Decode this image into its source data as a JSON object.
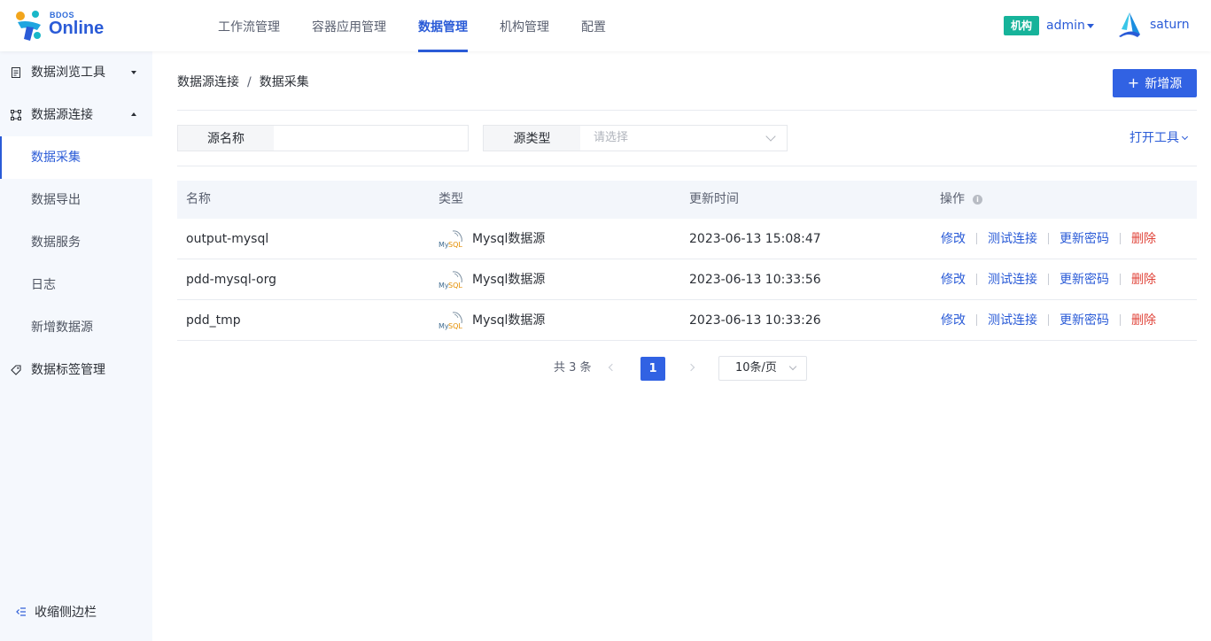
{
  "header": {
    "logo_small": "BDOS",
    "logo_big": "Online",
    "nav": [
      "工作流管理",
      "容器应用管理",
      "数据管理",
      "机构管理",
      "配置"
    ],
    "active_nav": "数据管理",
    "org_badge": "机构",
    "user": "admin",
    "tenant": "saturn",
    "colors": {
      "accent": "#2a5bd7",
      "badge": "#16b39a"
    }
  },
  "sidebar": {
    "items": [
      {
        "label": "数据浏览工具",
        "icon": "report-icon"
      },
      {
        "label": "数据源连接",
        "icon": "connection-icon"
      },
      {
        "label": "数据标签管理",
        "icon": "tag-icon"
      }
    ],
    "sub_items": [
      "数据采集",
      "数据导出",
      "数据服务",
      "日志",
      "新增数据源"
    ],
    "active_sub": "数据采集",
    "collapse_label": "收缩侧边栏"
  },
  "main": {
    "breadcrumb": [
      "数据源连接",
      "数据采集"
    ],
    "add_button": "新增源",
    "filters": {
      "name_label": "源名称",
      "name_value": "",
      "type_label": "源类型",
      "type_placeholder": "请选择"
    },
    "open_tools": "打开工具",
    "table": {
      "columns": [
        "名称",
        "类型",
        "更新时间",
        "操作"
      ],
      "rows": [
        {
          "name": "output-mysql",
          "type": "Mysql数据源",
          "updated": "2023-06-13 15:08:47"
        },
        {
          "name": "pdd-mysql-org",
          "type": "Mysql数据源",
          "updated": "2023-06-13 10:33:56"
        },
        {
          "name": "pdd_tmp",
          "type": "Mysql数据源",
          "updated": "2023-06-13 10:33:26"
        }
      ],
      "actions": [
        "修改",
        "测试连接",
        "更新密码",
        "删除"
      ]
    },
    "pagination": {
      "total": "共 3 条",
      "current": "1",
      "page_size": "10条/页"
    }
  }
}
